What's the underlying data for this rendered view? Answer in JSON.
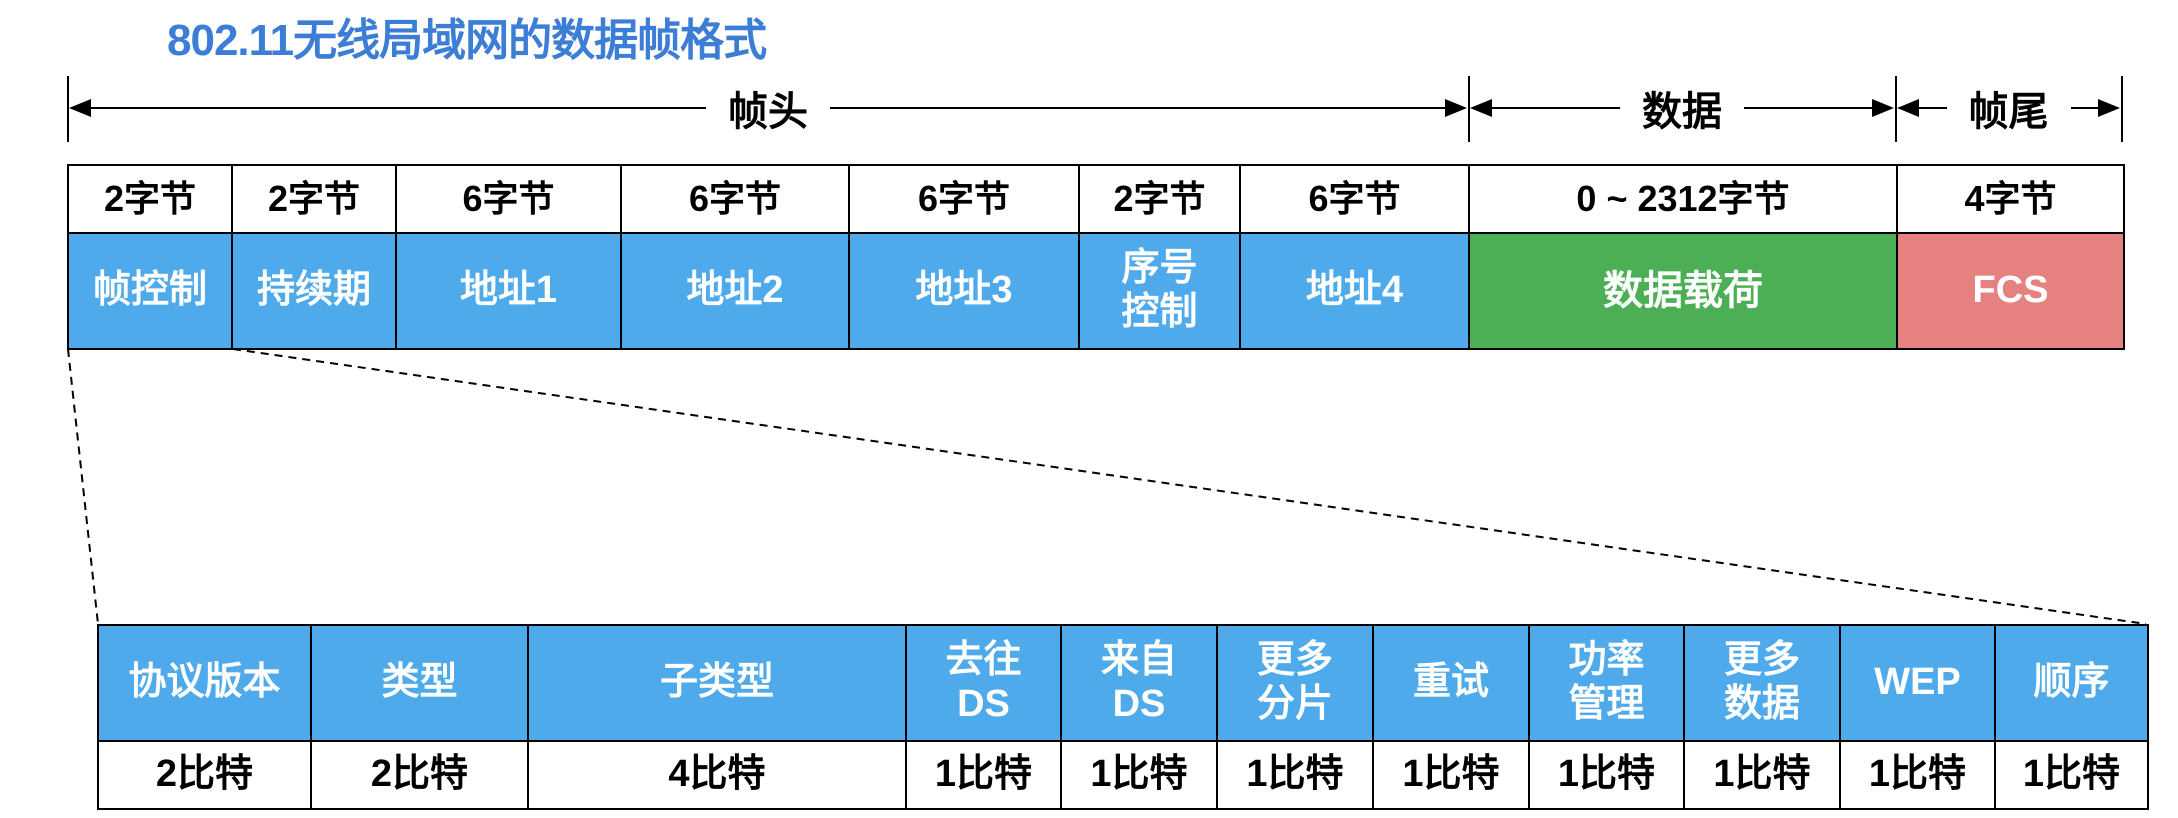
{
  "title": "802.11无线局域网的数据帧格式",
  "sections": {
    "header": "帧头",
    "data": "数据",
    "trailer": "帧尾"
  },
  "frame_fields": [
    {
      "size": "2字节",
      "name": "帧控制"
    },
    {
      "size": "2字节",
      "name": "持续期"
    },
    {
      "size": "6字节",
      "name": "地址1"
    },
    {
      "size": "6字节",
      "name": "地址2"
    },
    {
      "size": "6字节",
      "name": "地址3"
    },
    {
      "size": "2字节",
      "name_line1": "序号",
      "name_line2": "控制"
    },
    {
      "size": "6字节",
      "name": "地址4"
    },
    {
      "size": "0 ~ 2312字节",
      "name": "数据载荷"
    },
    {
      "size": "4字节",
      "name": "FCS"
    }
  ],
  "control_fields": [
    {
      "name": "协议版本",
      "bits": "2比特"
    },
    {
      "name": "类型",
      "bits": "2比特"
    },
    {
      "name": "子类型",
      "bits": "4比特"
    },
    {
      "name_line1": "去往",
      "name_line2": "DS",
      "bits": "1比特"
    },
    {
      "name_line1": "来自",
      "name_line2": "DS",
      "bits": "1比特"
    },
    {
      "name_line1": "更多",
      "name_line2": "分片",
      "bits": "1比特"
    },
    {
      "name": "重试",
      "bits": "1比特"
    },
    {
      "name_line1": "功率",
      "name_line2": "管理",
      "bits": "1比特"
    },
    {
      "name_line1": "更多",
      "name_line2": "数据",
      "bits": "1比特"
    },
    {
      "name": "WEP",
      "bits": "1比特"
    },
    {
      "name": "顺序",
      "bits": "1比特"
    }
  ],
  "colors": {
    "title": "#3c7ed6",
    "header_fields": "#4eaaeb",
    "payload": "#4caf55",
    "fcs": "#e5827f"
  }
}
